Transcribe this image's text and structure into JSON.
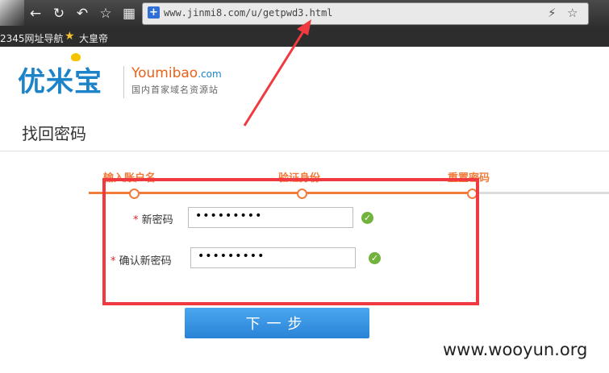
{
  "browser": {
    "url": "www.jinmi8.com/u/getpwd3.html",
    "bookmarks": [
      "2345网址导航",
      "大皇帝"
    ]
  },
  "logo": {
    "cn": "优米宝",
    "en_main": "Youmibao",
    "en_suffix": ".com",
    "tagline": "国内首家域名资源站"
  },
  "page": {
    "title": "找回密码"
  },
  "steps": [
    {
      "label": "输入账户名"
    },
    {
      "label": "验证身份"
    },
    {
      "label": "重置密码"
    }
  ],
  "form": {
    "required_mark": "*",
    "new_password_label": "新密码",
    "new_password_value": "•••••••••",
    "confirm_password_label": "确认新密码",
    "confirm_password_value": "•••••••••",
    "next_button": "下一步"
  },
  "annotation": {
    "highlight_color": "#f03a3f"
  },
  "watermark": "www.wooyun.org"
}
